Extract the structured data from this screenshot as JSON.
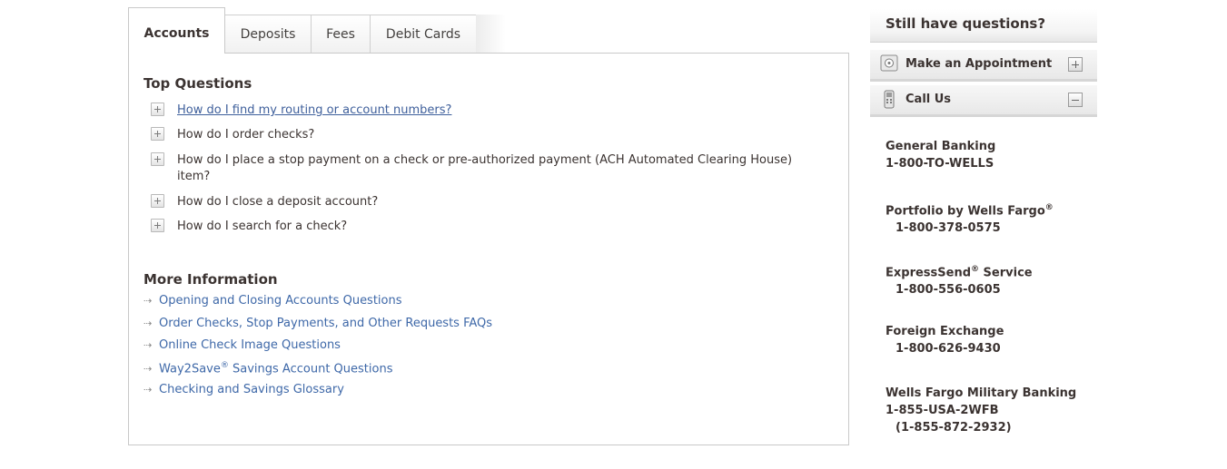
{
  "tabs": [
    {
      "label": "Accounts",
      "active": true
    },
    {
      "label": "Deposits",
      "active": false
    },
    {
      "label": "Fees",
      "active": false
    },
    {
      "label": "Debit Cards",
      "active": false
    }
  ],
  "top_questions": {
    "heading": "Top Questions",
    "items": [
      {
        "text": "How do I find my routing or account numbers?",
        "is_link": true
      },
      {
        "text": "How do I order checks?",
        "is_link": false
      },
      {
        "text": "How do I place a stop payment on a check or pre-authorized payment (ACH Automated Clearing House) item?",
        "is_link": false
      },
      {
        "text": "How do I close a deposit account?",
        "is_link": false
      },
      {
        "text": "How do I search for a check?",
        "is_link": false
      }
    ]
  },
  "more_information": {
    "heading": "More Information",
    "links": [
      {
        "text": "Opening and Closing Accounts Questions"
      },
      {
        "text": "Order Checks, Stop Payments, and Other Requests FAQs"
      },
      {
        "text": "Online Check Image Questions"
      },
      {
        "text": "Way2Save",
        "sup": "®",
        "text_after": " Savings Account Questions"
      },
      {
        "text": "Checking and Savings Glossary"
      }
    ]
  },
  "sidebar": {
    "title": "Still have questions?",
    "appointment": {
      "label": "Make an Appointment",
      "icon": "safe-icon",
      "state": "collapsed"
    },
    "call_us": {
      "label": "Call Us",
      "icon": "phone-icon",
      "state": "expanded"
    },
    "contacts": [
      {
        "name": "General Banking",
        "number": "1-800-TO-WELLS"
      },
      {
        "name": "Portfolio by Wells Fargo",
        "sup": "®",
        "number": "1-800-378-0575"
      },
      {
        "name": "ExpressSend",
        "sup": "®",
        "name_after": " Service",
        "number": "1-800-556-0605"
      },
      {
        "name": "Foreign Exchange",
        "number": "1-800-626-9430"
      },
      {
        "name": "Wells Fargo Military Banking",
        "number": "1-855-USA-2WFB",
        "alt_number": "1-855-872-2932"
      }
    ]
  },
  "colors": {
    "link": "#3e68a8",
    "text": "#3b3331",
    "border": "#c9c9c9"
  }
}
